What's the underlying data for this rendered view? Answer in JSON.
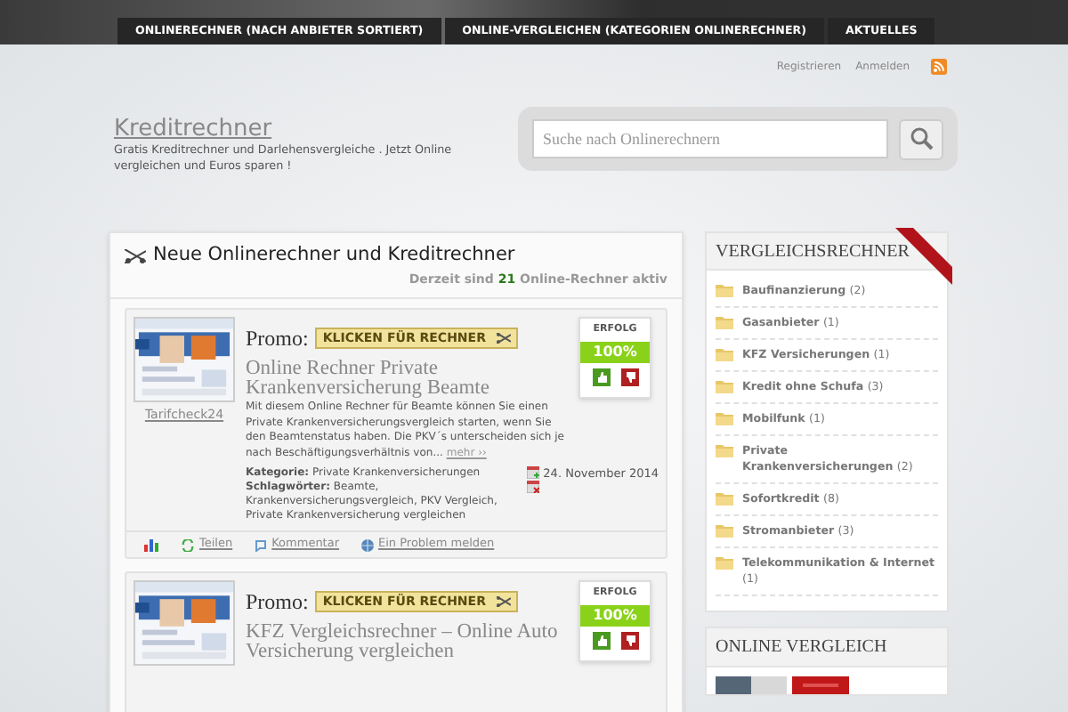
{
  "nav": [
    {
      "label": "ONLINERECHNER (NACH ANBIETER SORTIERT)"
    },
    {
      "label": "ONLINE-VERGLEICHEN (KATEGORIEN ONLINERECHNER)"
    },
    {
      "label": "AKTUELLES"
    }
  ],
  "header_links": [
    "Registrieren",
    "Anmelden"
  ],
  "site": {
    "title": "Kreditrechner",
    "tagline": "Gratis Kreditrechner und Darlehensvergleiche . Jetzt Online vergleichen und Euros sparen !"
  },
  "search": {
    "placeholder": "Suche nach Onlinerechnern"
  },
  "main": {
    "heading": "Neue Onlinerechner und Kreditrechner",
    "status_before": "Derzeit sind",
    "status_count": "21",
    "status_after": "Online-Rechner aktiv"
  },
  "posts": [
    {
      "thumbnail_caption": "Tarifcheck24",
      "promo_label": "Promo:",
      "promo_button": "KLICKEN FÜR RECHNER",
      "rating_label": "ERFOLG",
      "rating": "100%",
      "level": 1,
      "title": "Online Rechner Private Krankenversicherung Beamte",
      "excerpt": "Mit diesem Online Rechner für Beamte können Sie einen Private Krankenversicherungsvergleich starten, wenn Sie den Beamtenstatus haben. Die PKV´s unterscheiden sich je nach Beschäftigungsverhältnis von...",
      "more": "mehr ››",
      "category_label": "Kategorie:",
      "category": "Private Krankenversicherungen",
      "tags_label": "Schlagwörter:",
      "tags": "Beamte, Krankenversicherungsvergleich, PKV Vergleich, Private Krankenversicherung vergleichen",
      "date": "24. November 2014",
      "actions": [
        "Teilen",
        "Kommentar",
        "Ein Problem melden"
      ]
    },
    {
      "promo_label": "Promo:",
      "promo_button": "KLICKEN FÜR RECHNER",
      "rating_label": "ERFOLG",
      "rating": "100%",
      "level": 1,
      "title": "KFZ Vergleichsrechner – Online Auto Versicherung vergleichen"
    }
  ],
  "sidebar": {
    "heading": "VERGLEICHSRECHNER",
    "items": [
      {
        "label": "Baufinanzierung",
        "count": "(2)"
      },
      {
        "label": "Gasanbieter",
        "count": "(1)"
      },
      {
        "label": "KFZ Versicherungen",
        "count": "(1)"
      },
      {
        "label": "Kredit ohne Schufa",
        "count": "(3)"
      },
      {
        "label": "Mobilfunk",
        "count": "(1)"
      },
      {
        "label": "Private Krankenversicherungen",
        "count": "(2)"
      },
      {
        "label": "Sofortkredit",
        "count": "(8)"
      },
      {
        "label": "Stromanbieter",
        "count": "(3)"
      },
      {
        "label": "Telekommunikation & Internet",
        "count": "(1)"
      }
    ]
  },
  "sidebar2": {
    "heading": "ONLINE VERGLEICH"
  }
}
